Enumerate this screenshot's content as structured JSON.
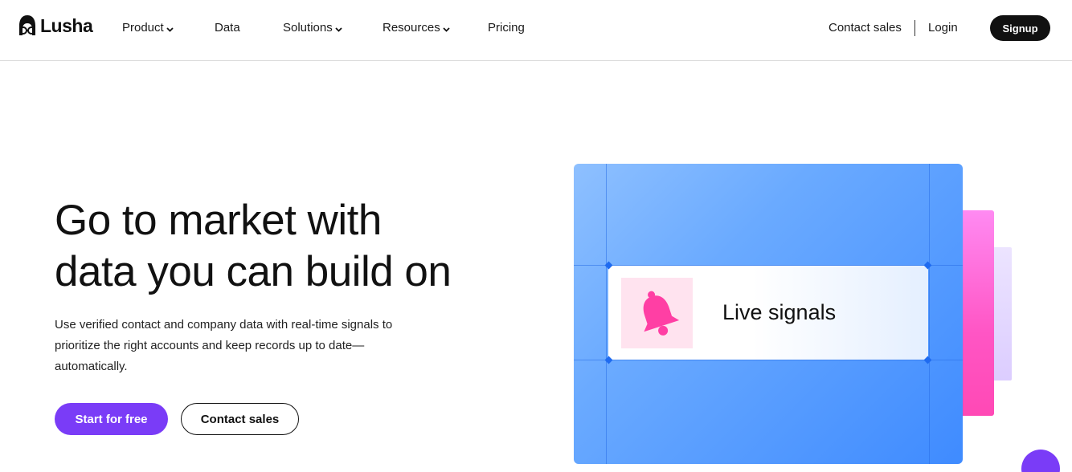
{
  "brand": {
    "name": "Lusha",
    "logo_icon": "lusha-glasses-person-icon"
  },
  "nav": {
    "items": [
      {
        "label": "Product",
        "has_dropdown": true
      },
      {
        "label": "Data",
        "has_dropdown": false
      },
      {
        "label": "Solutions",
        "has_dropdown": true
      },
      {
        "label": "Resources",
        "has_dropdown": true
      },
      {
        "label": "Pricing",
        "has_dropdown": false
      }
    ],
    "contact_sales": "Contact sales",
    "login": "Login",
    "signup": "Signup"
  },
  "hero": {
    "title_line1": "Go to market with",
    "title_line2": "data you can build on",
    "subtitle": "Use verified contact and company data with real-time signals to prioritize the right accounts and keep records up to date—automatically.",
    "primary_cta": "Start for free",
    "secondary_cta": "Contact sales"
  },
  "illustration": {
    "card_label": "Live signals",
    "card_icon": "bell-icon"
  },
  "colors": {
    "accent_purple": "#7a3cf7",
    "signup_bg": "#111111",
    "blue_card": "#5b9dff",
    "pink_panel": "#ff55c4",
    "bell": "#ff3fa4",
    "bell_bg": "#ffe3ef"
  }
}
